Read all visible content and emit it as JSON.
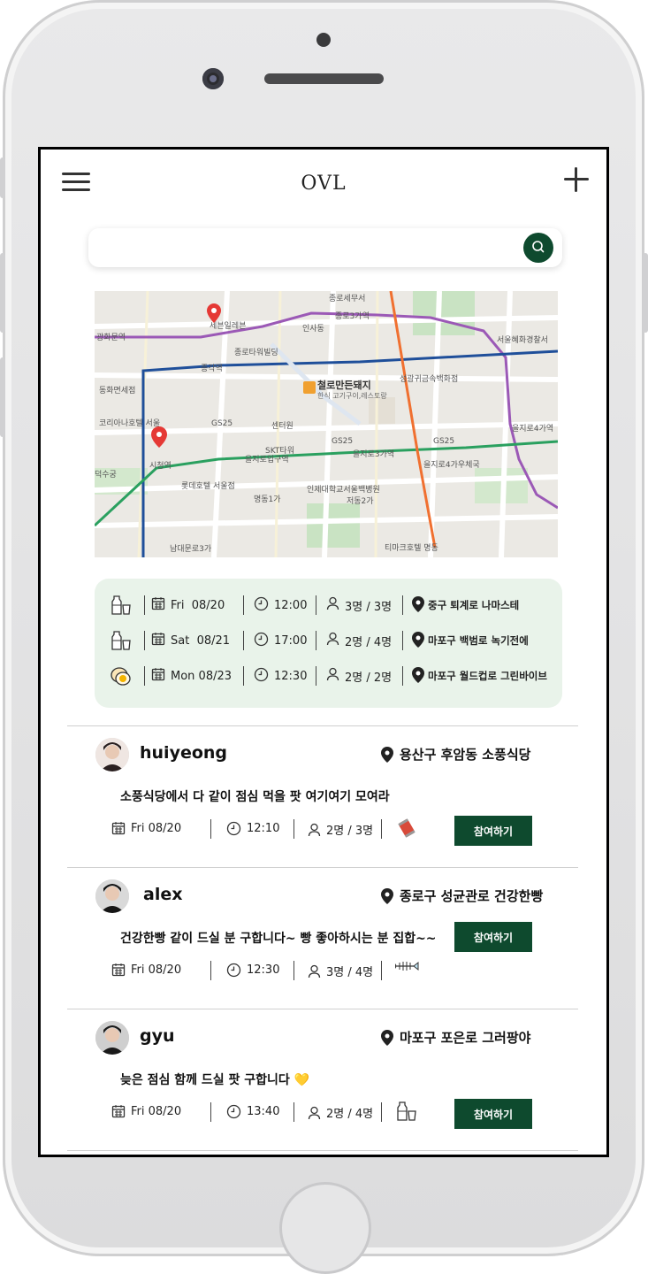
{
  "header": {
    "title": "OVL"
  },
  "search": {
    "placeholder": ""
  },
  "map": {
    "labels": {
      "pin_store": "세븐일레븐",
      "jongno": "종로세무서",
      "jongno3": "종로3가역",
      "gwanghwamun": "광화문역",
      "tower": "종로타워빌딩",
      "jonggak": "종각역",
      "restaurant": "철로만든돼지",
      "restaurant_sub": "한식 고기구이,레스토랑",
      "seoul_hospital": "서울혜화경찰서",
      "eulji4": "을지로4가역",
      "eulji3": "을지로3가역",
      "eulji1": "을지로입구역",
      "cityhall": "시청역",
      "gs25_a": "GS25",
      "gs25_b": "GS25",
      "gs25_c": "GS25",
      "skt": "SKT타워",
      "center": "센터원",
      "lotte": "롯데호텔 서울점",
      "paik": "인제대학교서울백병원",
      "doksu": "덕수궁",
      "koreana": "코리아나호텔 서울",
      "myeongdong": "명동1가",
      "jeodong": "저동2가",
      "gold": "을지로4가우체국",
      "dongwha": "동화면세점",
      "seongdong": "성광귀금속백화점",
      "insa": "인사동",
      "namdaemun": "남대문로3가",
      "timark": "티마크호텔 명동"
    }
  },
  "schedule": [
    {
      "icon": "milk-icon",
      "date": "Fri  08/20",
      "time": "12:00",
      "people": "3명 / 3명",
      "place": "중구 퇴계로 나마스테"
    },
    {
      "icon": "milk-icon",
      "date": "Sat  08/21",
      "time": "17:00",
      "people": "2명 / 4명",
      "place": "마포구 백범로 녹기전에"
    },
    {
      "icon": "egg-icon",
      "date": "Mon 08/23",
      "time": "12:30",
      "people": "2명 / 2명",
      "place": "마포구 월드컵로 그린바이브"
    }
  ],
  "posts": [
    {
      "username": "huiyeong",
      "location": "용산구 후암동 소풍식당",
      "message": "소풍식당에서 다 같이 점심 먹을 팟 여기여기 모여라",
      "date": "Fri 08/20",
      "time": "12:10",
      "people": "2명 / 3명",
      "category_icon": "drink-can-icon",
      "join_label": "참여하기"
    },
    {
      "username": "alex",
      "location": "종로구 성균관로 건강한빵",
      "message": "건강한빵 같이 드실 분 구합니다~ 빵 좋아하시는 분 집합~~",
      "date": "Fri 08/20",
      "time": "12:30",
      "people": "3명 / 4명",
      "category_icon": "fish-bone-icon",
      "join_label": "참여하기"
    },
    {
      "username": "gyu",
      "location": "마포구 포은로 그러팡야",
      "message": "늦은 점심 함께 드실 팟 구합니다 💛",
      "date": "Fri 08/20",
      "time": "13:40",
      "people": "2명 / 4명",
      "category_icon": "milk-icon",
      "join_label": "참여하기"
    }
  ],
  "colors": {
    "accent": "#0e4a2e",
    "schedule_bg": "#e9f3ea"
  }
}
